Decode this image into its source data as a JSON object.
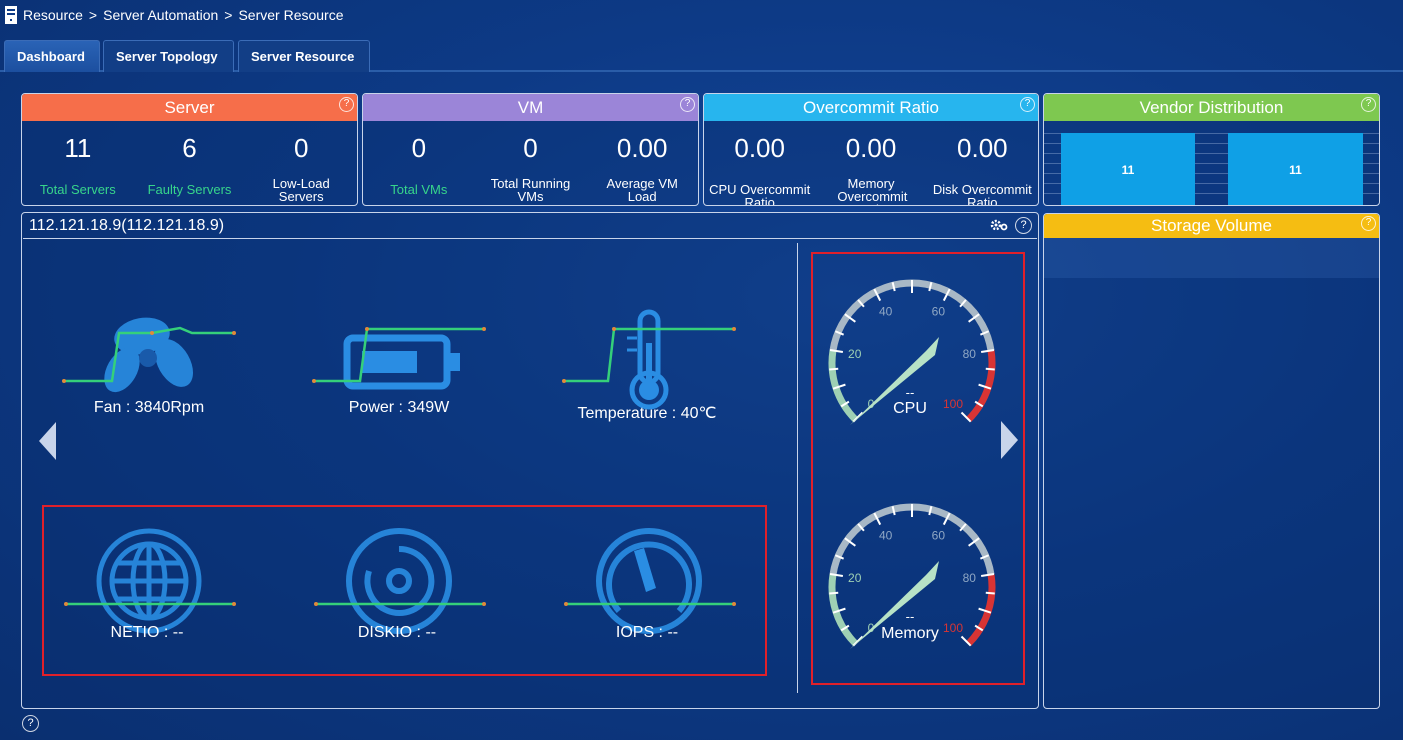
{
  "breadcrumb": [
    "Resource",
    "Server Automation",
    "Server Resource"
  ],
  "tabs": [
    "Dashboard",
    "Server Topology",
    "Server Resource"
  ],
  "cards": {
    "server": {
      "title": "Server",
      "color": "#f66e4a",
      "stats": [
        {
          "value": "11",
          "label": "Total Servers"
        },
        {
          "value": "6",
          "label": "Faulty Servers"
        },
        {
          "value": "0",
          "label": "Low-Load Servers"
        }
      ]
    },
    "vm": {
      "title": "VM",
      "color": "#9b85d8",
      "stats": [
        {
          "value": "0",
          "label": "Total VMs"
        },
        {
          "value": "0",
          "label": "Total Running VMs"
        },
        {
          "value": "0.00",
          "label": "Average VM Load"
        }
      ]
    },
    "overcommit": {
      "title": "Overcommit Ratio",
      "color": "#27b5ee",
      "stats": [
        {
          "value": "0.00",
          "label": "CPU Overcommit Ratio"
        },
        {
          "value": "0.00",
          "label": "Memory Overcommit Ratio"
        },
        {
          "value": "0.00",
          "label": "Disk Overcommit Ratio"
        }
      ]
    },
    "vendor": {
      "title": "Vendor Distribution",
      "color": "#7ec850",
      "bars": [
        "11",
        "11"
      ]
    },
    "storage": {
      "title": "Storage Volume",
      "color": "#f5bd12"
    }
  },
  "panel": {
    "title": "112.121.18.9(112.121.18.9)",
    "hardware": {
      "fan": "Fan : 3840Rpm",
      "power": "Power : 349W",
      "temperature": "Temperature : 40℃"
    },
    "io": {
      "netio": "NETIO : --",
      "diskio": "DISKIO : --",
      "iops": "IOPS : --"
    },
    "gauges": [
      {
        "name": "CPU",
        "value": "--",
        "ticks": [
          "0",
          "20",
          "40",
          "60",
          "80",
          "100"
        ]
      },
      {
        "name": "Memory",
        "value": "--",
        "ticks": [
          "0",
          "20",
          "40",
          "60",
          "80",
          "100"
        ]
      }
    ]
  },
  "help_glyph": "?",
  "colors": {
    "accent_green": "#37d58b",
    "alert_red": "#e0202a",
    "line_green": "#35d07a"
  }
}
